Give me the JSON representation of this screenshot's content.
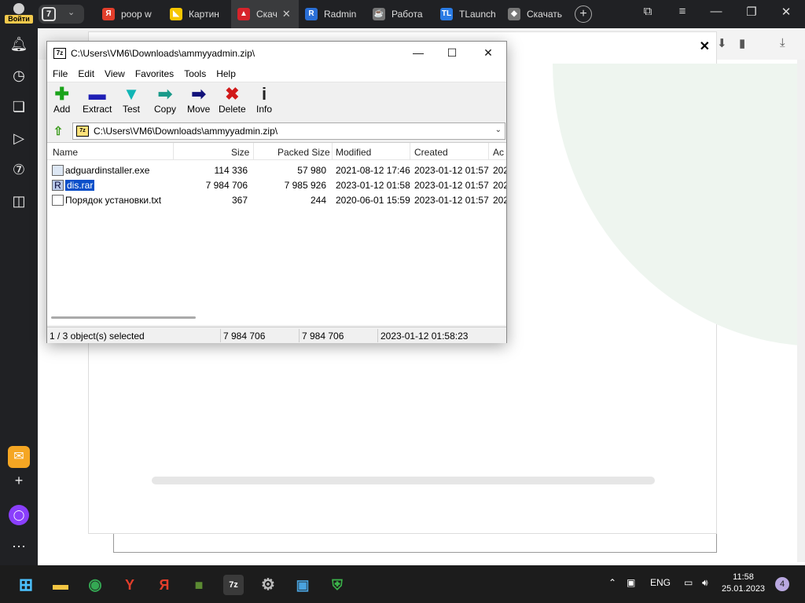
{
  "browser": {
    "profile_label": "Войти",
    "tab_count": "7",
    "tabs": [
      {
        "label": "poop w",
        "icon": "yandex-search-icon",
        "color": "#e23e2b",
        "glyph": "Я"
      },
      {
        "label": "Картин",
        "icon": "yandex-images-icon",
        "color": "#f7c600",
        "glyph": "◣"
      },
      {
        "label": "Скач",
        "icon": "download-site-icon",
        "color": "#d6232b",
        "glyph": "▲"
      },
      {
        "label": "Radmin",
        "icon": "radmin-icon",
        "color": "#2a6fd6",
        "glyph": "R"
      },
      {
        "label": "Работа",
        "icon": "coffee-icon",
        "color": "#777777",
        "glyph": "☕"
      },
      {
        "label": "TLaunch",
        "icon": "tlauncher-icon",
        "color": "#2a7be4",
        "glyph": "TL"
      },
      {
        "label": "Скачать",
        "icon": "package-icon",
        "color": "#777777",
        "glyph": "◆"
      }
    ],
    "new_tab": "+"
  },
  "zip_window": {
    "title": "C:\\Users\\VM6\\Downloads\\ammyyadmin.zip\\",
    "app_icon": "7z",
    "menu": [
      "File",
      "Edit",
      "View",
      "Favorites",
      "Tools",
      "Help"
    ],
    "toolbar": [
      {
        "label": "Add",
        "icon": "add-icon",
        "glyph": "✚",
        "color": "#1aa31a"
      },
      {
        "label": "Extract",
        "icon": "extract-icon",
        "glyph": "▬",
        "color": "#1f1fb5"
      },
      {
        "label": "Test",
        "icon": "test-icon",
        "glyph": "▼",
        "color": "#11b5b5"
      },
      {
        "label": "Copy",
        "icon": "copy-icon",
        "glyph": "➡",
        "color": "#1a9a8a"
      },
      {
        "label": "Move",
        "icon": "move-icon",
        "glyph": "➡",
        "color": "#11117a"
      },
      {
        "label": "Delete",
        "icon": "delete-icon",
        "glyph": "✖",
        "color": "#d11a1a"
      },
      {
        "label": "Info",
        "icon": "info-icon",
        "glyph": "i",
        "color": "#222222"
      }
    ],
    "address": "C:\\Users\\VM6\\Downloads\\ammyyadmin.zip\\",
    "columns": [
      "Name",
      "Size",
      "Packed Size",
      "Modified",
      "Created",
      "Ac"
    ],
    "files": [
      {
        "name": "adguardinstaller.exe",
        "size": "114 336",
        "packed": "57 980",
        "modified": "2021-08-12 17:46",
        "created": "2023-01-12 01:57",
        "accessed": "202",
        "type": "exe"
      },
      {
        "name": "dis.rar",
        "size": "7 984 706",
        "packed": "7 985 926",
        "modified": "2023-01-12 01:58",
        "created": "2023-01-12 01:57",
        "accessed": "202",
        "type": "rar"
      },
      {
        "name": "Порядок установки.txt",
        "size": "367",
        "packed": "244",
        "modified": "2020-06-01 15:59",
        "created": "2023-01-12 01:57",
        "accessed": "202",
        "type": "txt"
      }
    ],
    "status": {
      "selection": "1 / 3 object(s) selected",
      "size": "7 984 706",
      "packed": "7 984 706",
      "modified": "2023-01-12 01:58:23"
    }
  },
  "taskbar": {
    "lang": "ENG",
    "time": "11:58",
    "date": "25.01.2023",
    "notifications": "4"
  }
}
